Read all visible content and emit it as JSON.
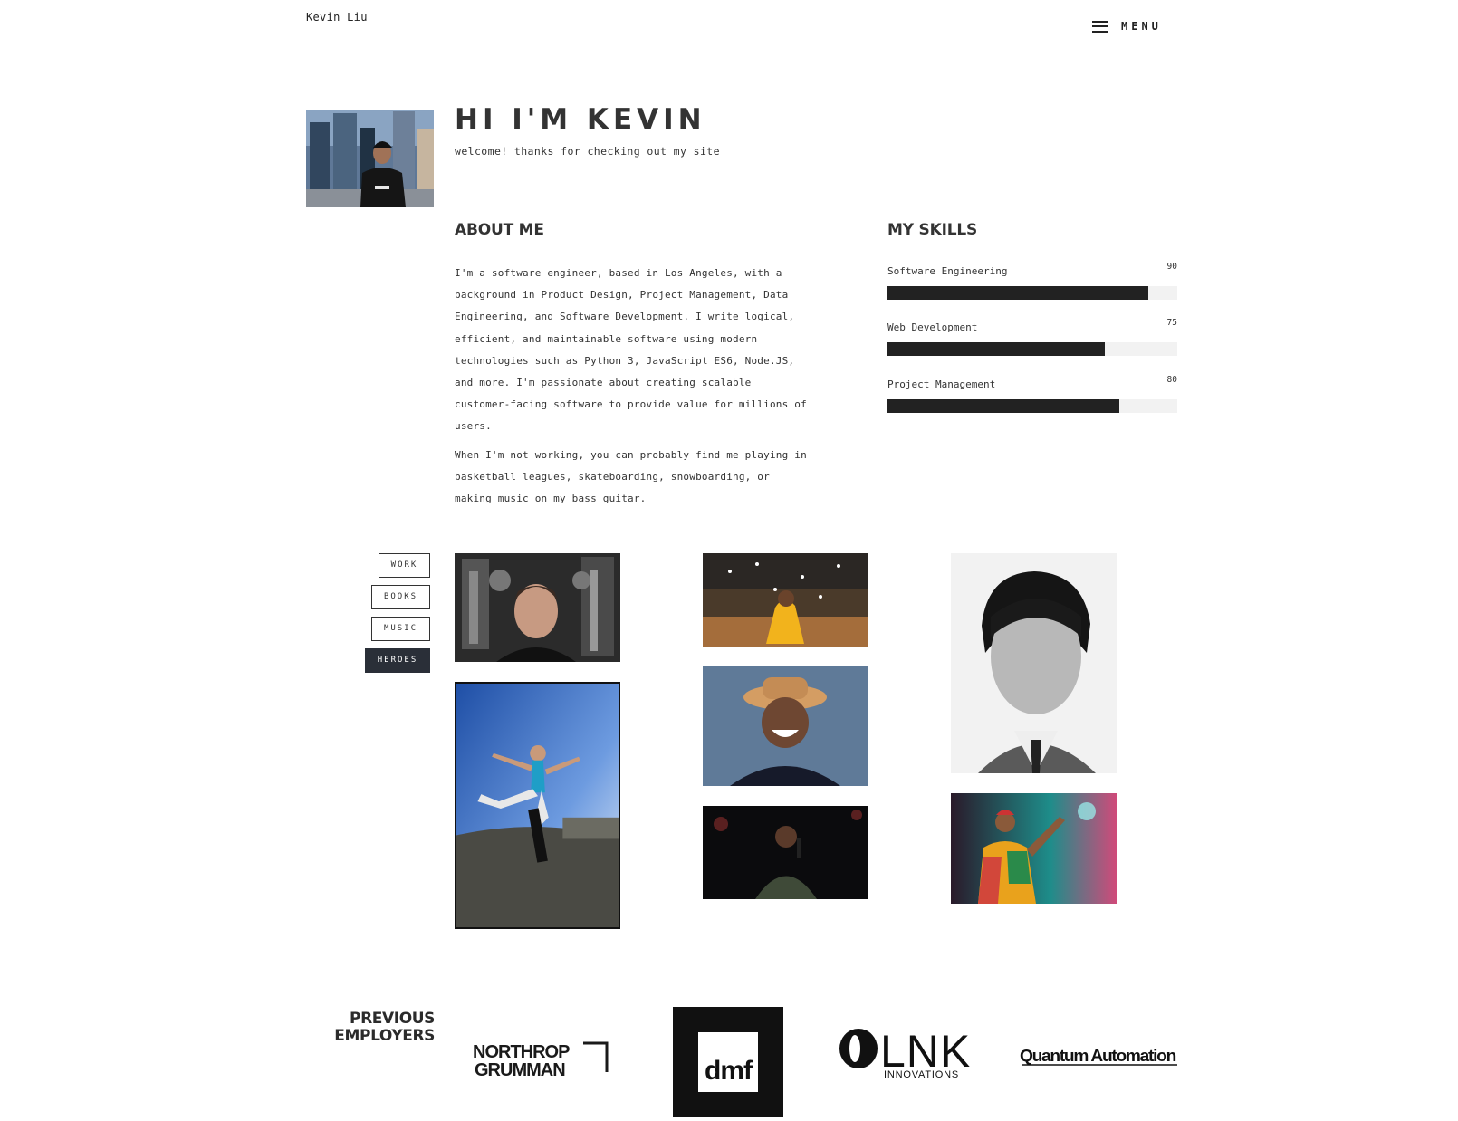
{
  "header": {
    "brand": "Kevin Liu",
    "menu_label": "MENU"
  },
  "hero": {
    "title": "HI I'M KEVIN",
    "subtitle": "welcome! thanks for checking out my site"
  },
  "about": {
    "heading": "ABOUT ME",
    "paragraphs": [
      "I'm a software engineer, based in Los Angeles, with a background in Product Design, Project Management, Data Engineering, and Software Development. I write logical, efficient, and maintainable software using modern technologies such as Python 3, JavaScript ES6, Node.JS, and more. I'm passionate about creating scalable customer-facing software to provide value for millions of users.",
      "When I'm not working, you can probably find me playing in basketball leagues, skateboarding, snowboarding, or making music on my bass guitar."
    ]
  },
  "skills": {
    "heading": "MY SKILLS",
    "items": [
      {
        "name": "Software Engineering",
        "value": "90",
        "percent": 90
      },
      {
        "name": "Web Development",
        "value": "75",
        "percent": 75
      },
      {
        "name": "Project Management",
        "value": "80",
        "percent": 80
      }
    ]
  },
  "filters": [
    {
      "label": "WORK",
      "active": false
    },
    {
      "label": "BOOKS",
      "active": false
    },
    {
      "label": "MUSIC",
      "active": false
    },
    {
      "label": "HEROES",
      "active": true
    }
  ],
  "employers": {
    "heading_line1": "PREVIOUS",
    "heading_line2": "EMPLOYERS",
    "logos": [
      {
        "line1": "NORTHROP",
        "line2": "GRUMMAN"
      },
      {
        "text": "dmf"
      },
      {
        "text": "LNK",
        "sub": "INNOVATIONS"
      },
      {
        "text": "Quantum Automation"
      }
    ]
  },
  "colors": {
    "text": "#2b2b2b",
    "skill_bar": "#222222",
    "skill_track": "#f2f2f2",
    "active_filter": "#2a2f38"
  }
}
